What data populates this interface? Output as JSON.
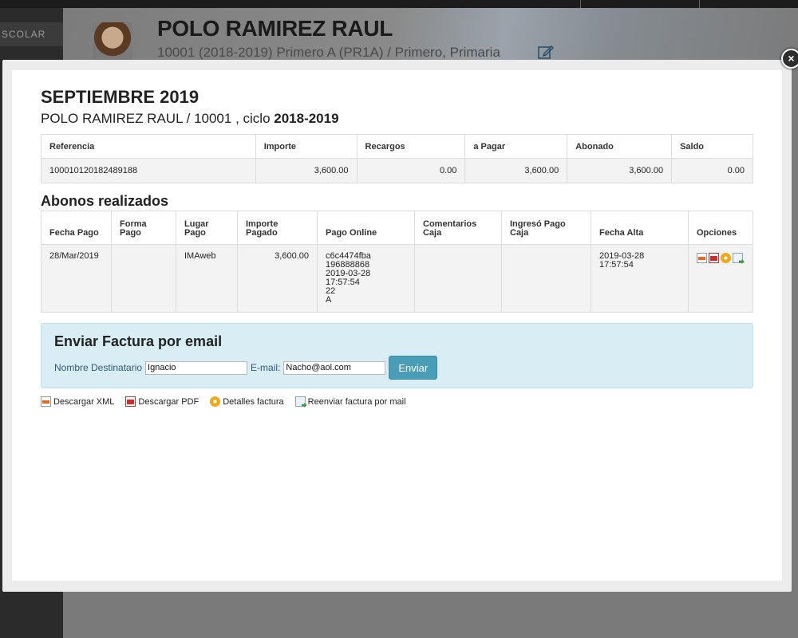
{
  "background": {
    "sidebar_label": "SCOLAR",
    "student_name": "POLO RAMIREZ RAUL",
    "student_sub": "10001 (2018-2019) Primero A (PR1A) / Primero, Primaria"
  },
  "modal": {
    "close_label": "×",
    "title": "SEPTIEMBRE 2019",
    "subtitle_prefix": "POLO RAMIREZ RAUL / 10001 , ciclo ",
    "subtitle_cycle": "2018-2019",
    "summary": {
      "headers": [
        "Referencia",
        "Importe",
        "Recargos",
        "a Pagar",
        "Abonado",
        "Saldo"
      ],
      "row": [
        "100010120182489188",
        "3,600.00",
        "0.00",
        "3,600.00",
        "3,600.00",
        "0.00"
      ]
    },
    "abonos_title": "Abonos realizados",
    "abonos": {
      "headers": [
        "Fecha Pago",
        "Forma Pago",
        "Lugar Pago",
        "Importe Pagado",
        "Pago Online",
        "Comentarios Caja",
        "Ingresó Pago Caja",
        "Fecha Alta",
        "Opciones"
      ],
      "row": {
        "fecha_pago": "28/Mar/2019",
        "forma_pago": "",
        "lugar_pago": "IMAweb",
        "importe_pagado": "3,600.00",
        "pago_online": "c6c4474fba\n196888868\n2019-03-28\n17:57:54\n22\nA",
        "comentarios_caja": "",
        "ingreso_pago_caja": "",
        "fecha_alta": "2019-03-28\n17:57:54"
      }
    },
    "email_form": {
      "title": "Enviar Factura por email",
      "name_label": "Nombre Destinatario",
      "name_value": "Ignacio",
      "email_label": "E-mail:",
      "email_value": "Nacho@aol.com",
      "send_label": "Enviar"
    },
    "links": {
      "xml": "Descargar XML",
      "pdf": "Descargar PDF",
      "details": "Detalles factura",
      "resend": "Reenviar factura por mail"
    }
  }
}
